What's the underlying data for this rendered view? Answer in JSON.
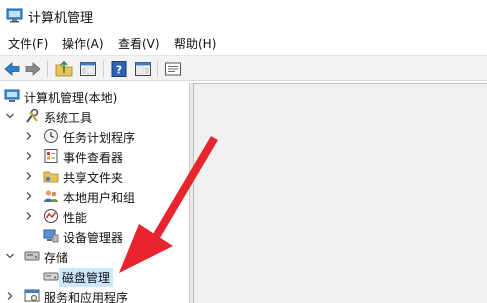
{
  "window": {
    "title": "计算机管理"
  },
  "menu": [
    {
      "label": "文件(F)"
    },
    {
      "label": "操作(A)"
    },
    {
      "label": "查看(V)"
    },
    {
      "label": "帮助(H)"
    }
  ],
  "toolbar": {
    "buttons": [
      "back-icon",
      "forward-icon",
      "folder-up-icon",
      "console-tree-icon",
      "help-icon",
      "show-pane-icon",
      "properties-icon"
    ]
  },
  "tree": {
    "root": "计算机管理(本地)",
    "system_tools": "系统工具",
    "task_scheduler": "任务计划程序",
    "event_viewer": "事件查看器",
    "shared_folders": "共享文件夹",
    "local_users": "本地用户和组",
    "performance": "性能",
    "device_manager": "设备管理器",
    "storage": "存储",
    "disk_management": "磁盘管理",
    "services_apps": "服务和应用程序"
  },
  "colors": {
    "annotation_arrow": "#e8242f",
    "selection": "#cce8ff",
    "toolbar_bg": "#f3f3f3",
    "content_bg": "#f0f0f0"
  }
}
